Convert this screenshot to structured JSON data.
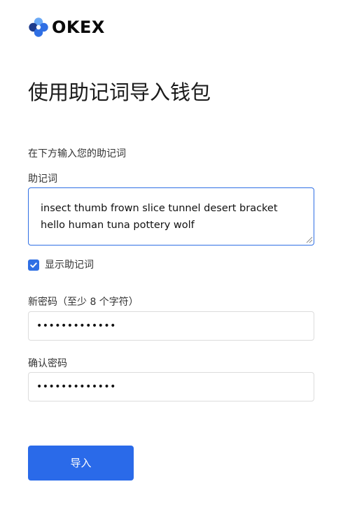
{
  "brand": {
    "logo_text": "OKEX",
    "logo_icon": "okex-logo-icon",
    "colors": {
      "accent": "#2a6ae9",
      "logo_dark": "#1e3c8c",
      "logo_mid": "#2f6fe4",
      "logo_light": "#6aa8f5"
    }
  },
  "page": {
    "title": "使用助记词导入钱包",
    "hint": "在下方输入您的助记词"
  },
  "mnemonic": {
    "label": "助记词",
    "value": "insect thumb frown slice tunnel desert bracket hello human tuna pottery wolf"
  },
  "show_mnemonic": {
    "label": "显示助记词",
    "checked": true,
    "icon": "checkmark-icon"
  },
  "new_password": {
    "label": "新密码（至少 8 个字符）",
    "masked_value": "•••••••••••••"
  },
  "confirm_password": {
    "label": "确认密码",
    "masked_value": "•••••••••••••"
  },
  "actions": {
    "import_label": "导入"
  }
}
